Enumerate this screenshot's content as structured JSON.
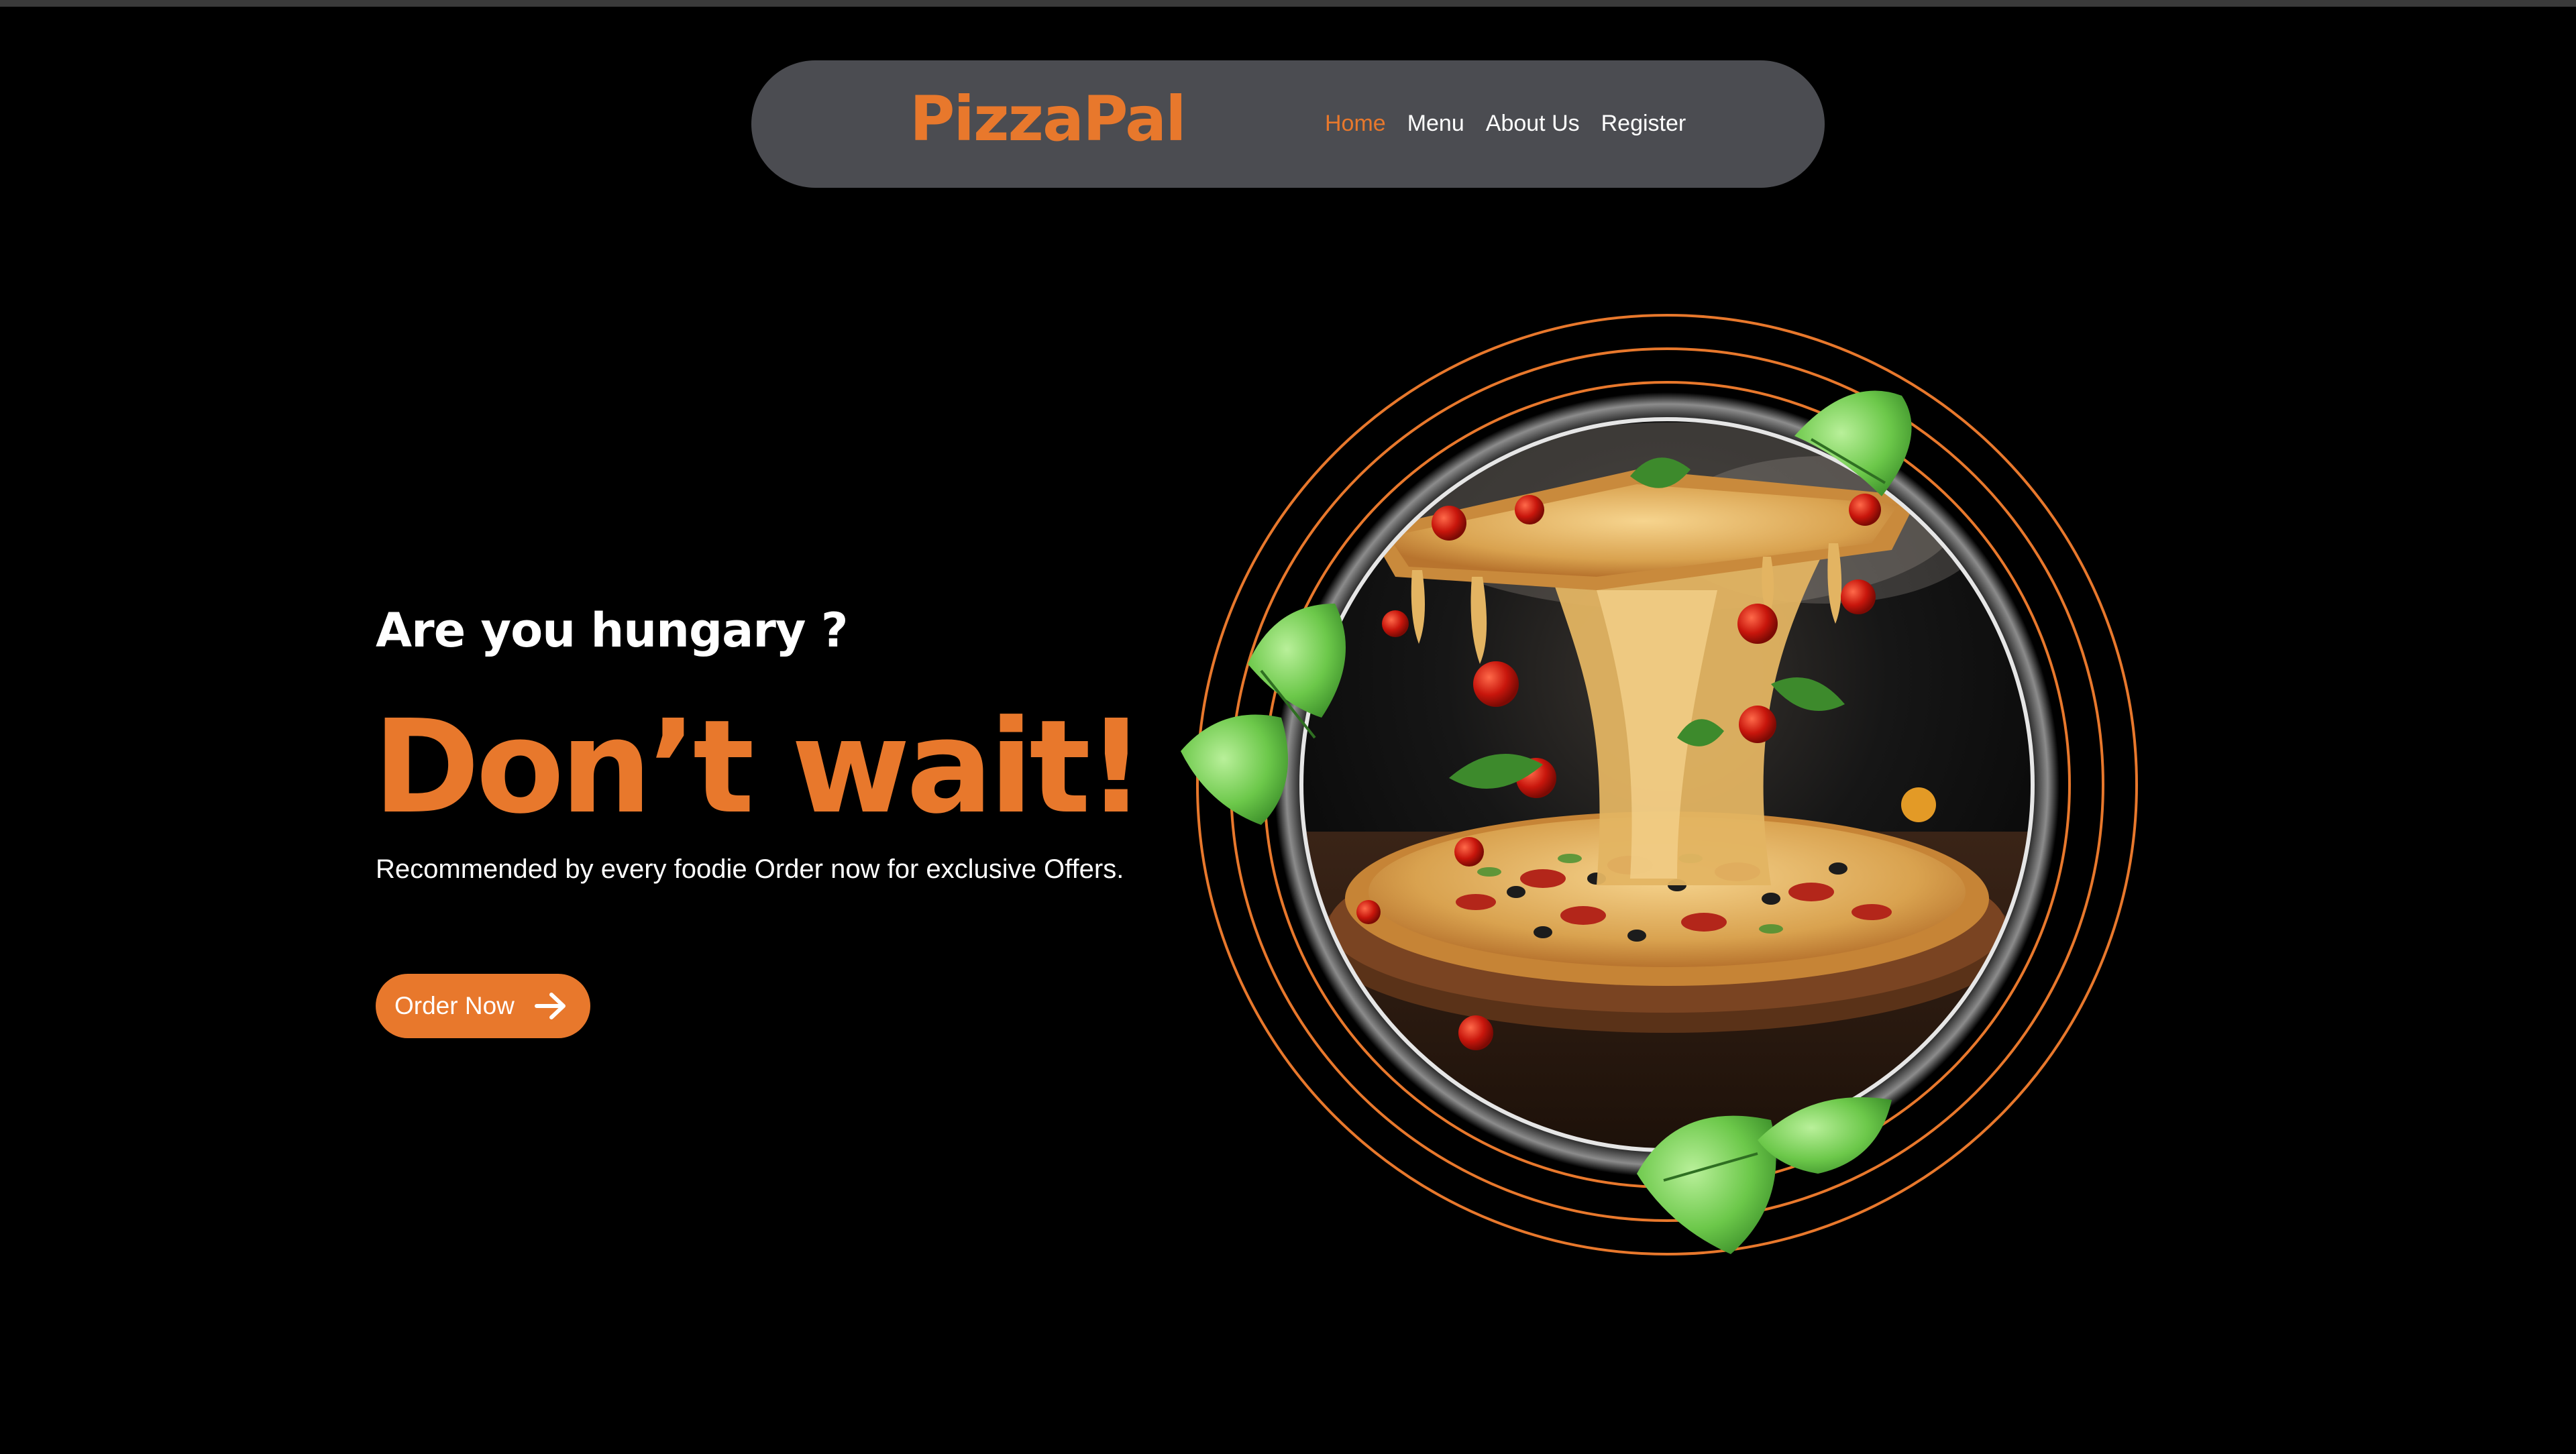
{
  "colors": {
    "background": "#000000",
    "accent": "#e8782c",
    "navbar": "#4b4c51",
    "text": "#ffffff"
  },
  "navbar": {
    "logo": "PizzaPal",
    "links": [
      {
        "label": "Home",
        "active": true
      },
      {
        "label": "Menu",
        "active": false
      },
      {
        "label": "About Us",
        "active": false
      },
      {
        "label": "Register",
        "active": false
      }
    ]
  },
  "hero": {
    "kicker": "Are you hungary ?",
    "title": "Don’t wait!",
    "subtitle": "Recommended by every foodie Order now for exclusive Offers.",
    "cta_label": "Order Now",
    "cta_icon": "arrow-right-icon",
    "image_icons": [
      "pizza-illustration",
      "mint-leaf-icon"
    ]
  }
}
